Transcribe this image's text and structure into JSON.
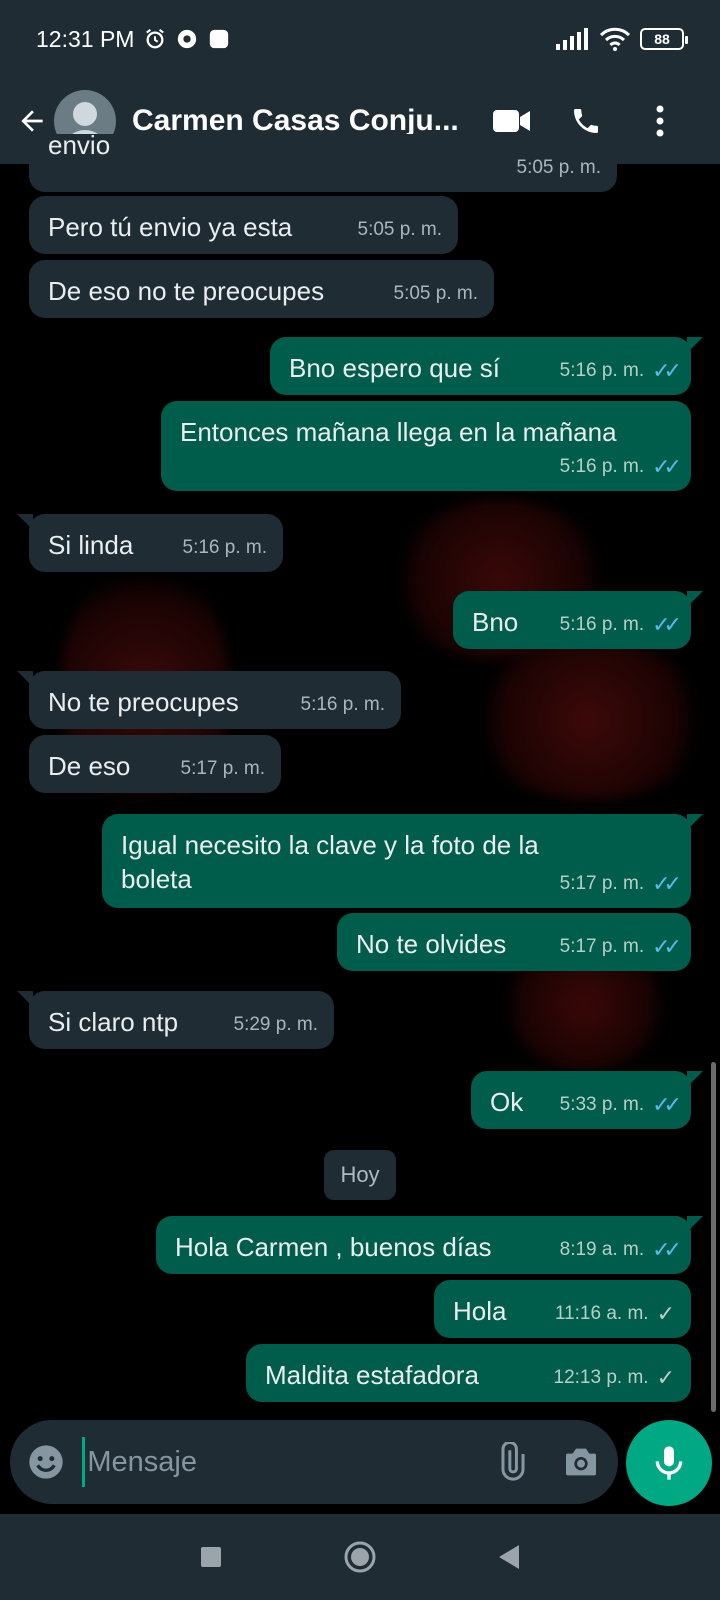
{
  "status_bar": {
    "time": "12:31 PM",
    "battery": "88"
  },
  "header": {
    "contact_name": "Carmen Casas Conju...",
    "icons": [
      "back-arrow-icon",
      "avatar",
      "video-call-icon",
      "phone-icon",
      "more-vert-icon"
    ]
  },
  "messages": [
    {
      "dir": "in",
      "text": "envio",
      "time": "5:05 p. m."
    },
    {
      "dir": "in",
      "text": "Pero tú envio ya esta",
      "time": "5:05 p. m."
    },
    {
      "dir": "in",
      "text": "De eso no te preocupes",
      "time": "5:05 p. m."
    },
    {
      "dir": "out",
      "text": "Bno espero que sí",
      "time": "5:16 p. m.",
      "ticks": "✓✓"
    },
    {
      "dir": "out",
      "text": "Entonces mañana llega en la mañana",
      "time": "5:16 p. m.",
      "ticks": "✓✓"
    },
    {
      "dir": "in",
      "text": "Si linda",
      "time": "5:16 p. m."
    },
    {
      "dir": "out",
      "text": "Bno",
      "time": "5:16 p. m.",
      "ticks": "✓✓"
    },
    {
      "dir": "in",
      "text": "No te preocupes",
      "time": "5:16 p. m."
    },
    {
      "dir": "in",
      "text": "De eso",
      "time": "5:17 p. m."
    },
    {
      "dir": "out",
      "text": "Igual necesito la clave y la foto de la boleta",
      "time": "5:17 p. m.",
      "ticks": "✓✓"
    },
    {
      "dir": "out",
      "text": "No te olvides",
      "time": "5:17 p. m.",
      "ticks": "✓✓"
    },
    {
      "dir": "in",
      "text": "Si claro ntp",
      "time": "5:29 p. m."
    },
    {
      "dir": "out",
      "text": "Ok",
      "time": "5:33 p. m.",
      "ticks": "✓✓"
    },
    {
      "dir": "out",
      "text": "Hola Carmen , buenos días",
      "time": "8:19 a. m.",
      "ticks": "✓✓"
    },
    {
      "dir": "out",
      "text": "Hola",
      "time": "11:16 a. m.",
      "ticks": "✓"
    },
    {
      "dir": "out",
      "text": "Maldita estafadora",
      "time": "12:13 p. m.",
      "ticks": "✓"
    }
  ],
  "day_separator": "Hoy",
  "composer": {
    "placeholder": "Mensaje"
  },
  "colors": {
    "header": "#1f2c34",
    "incoming": "#1f2c34",
    "outgoing": "#005c4b",
    "accent": "#00a884",
    "read_tick": "#53bdeb"
  }
}
